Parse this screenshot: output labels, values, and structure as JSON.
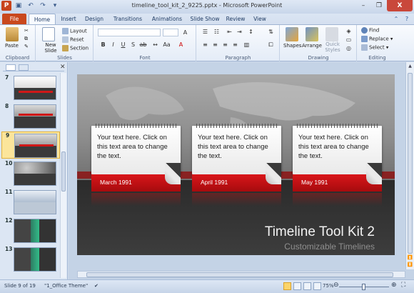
{
  "window": {
    "title": "timeline_tool_kit_2_9225.pptx - Microsoft PowerPoint",
    "app_icon": "P",
    "controls": [
      "–",
      "❐",
      "X"
    ]
  },
  "tabs": [
    "File",
    "Home",
    "Insert",
    "Design",
    "Transitions",
    "Animations",
    "Slide Show",
    "Review",
    "View"
  ],
  "ribbon": {
    "clipboard": {
      "name": "Clipboard",
      "paste": "Paste"
    },
    "slides": {
      "name": "Slides",
      "new_slide": "New Slide",
      "layout": "Layout",
      "reset": "Reset",
      "section": "Section"
    },
    "font": {
      "name": "Font"
    },
    "paragraph": {
      "name": "Paragraph"
    },
    "drawing": {
      "name": "Drawing",
      "shapes": "Shapes",
      "arrange": "Arrange",
      "quick_styles": "Quick Styles"
    },
    "editing": {
      "name": "Editing",
      "find": "Find",
      "replace": "Replace",
      "select": "Select"
    }
  },
  "thumbnails": [
    {
      "num": "7"
    },
    {
      "num": "8"
    },
    {
      "num": "9"
    },
    {
      "num": "10"
    },
    {
      "num": "11"
    },
    {
      "num": "12"
    },
    {
      "num": "13"
    }
  ],
  "slide": {
    "cards": [
      {
        "text": "Your text here. Click on this text area to change the text.",
        "date": "March 1991"
      },
      {
        "text": "Your text here. Click on this text area to change the text.",
        "date": "April 1991"
      },
      {
        "text": "Your text here. Click on this text area to change the text.",
        "date": "May 1991"
      }
    ],
    "title": "Timeline Tool Kit 2",
    "subtitle": "Customizable Timelines"
  },
  "status": {
    "slide_info": "Slide 9 of 19",
    "theme": "\"1_Office Theme\"",
    "zoom": "75%"
  },
  "colors": {
    "accent_red": "#d9161a",
    "file_tab": "#c9481d"
  }
}
